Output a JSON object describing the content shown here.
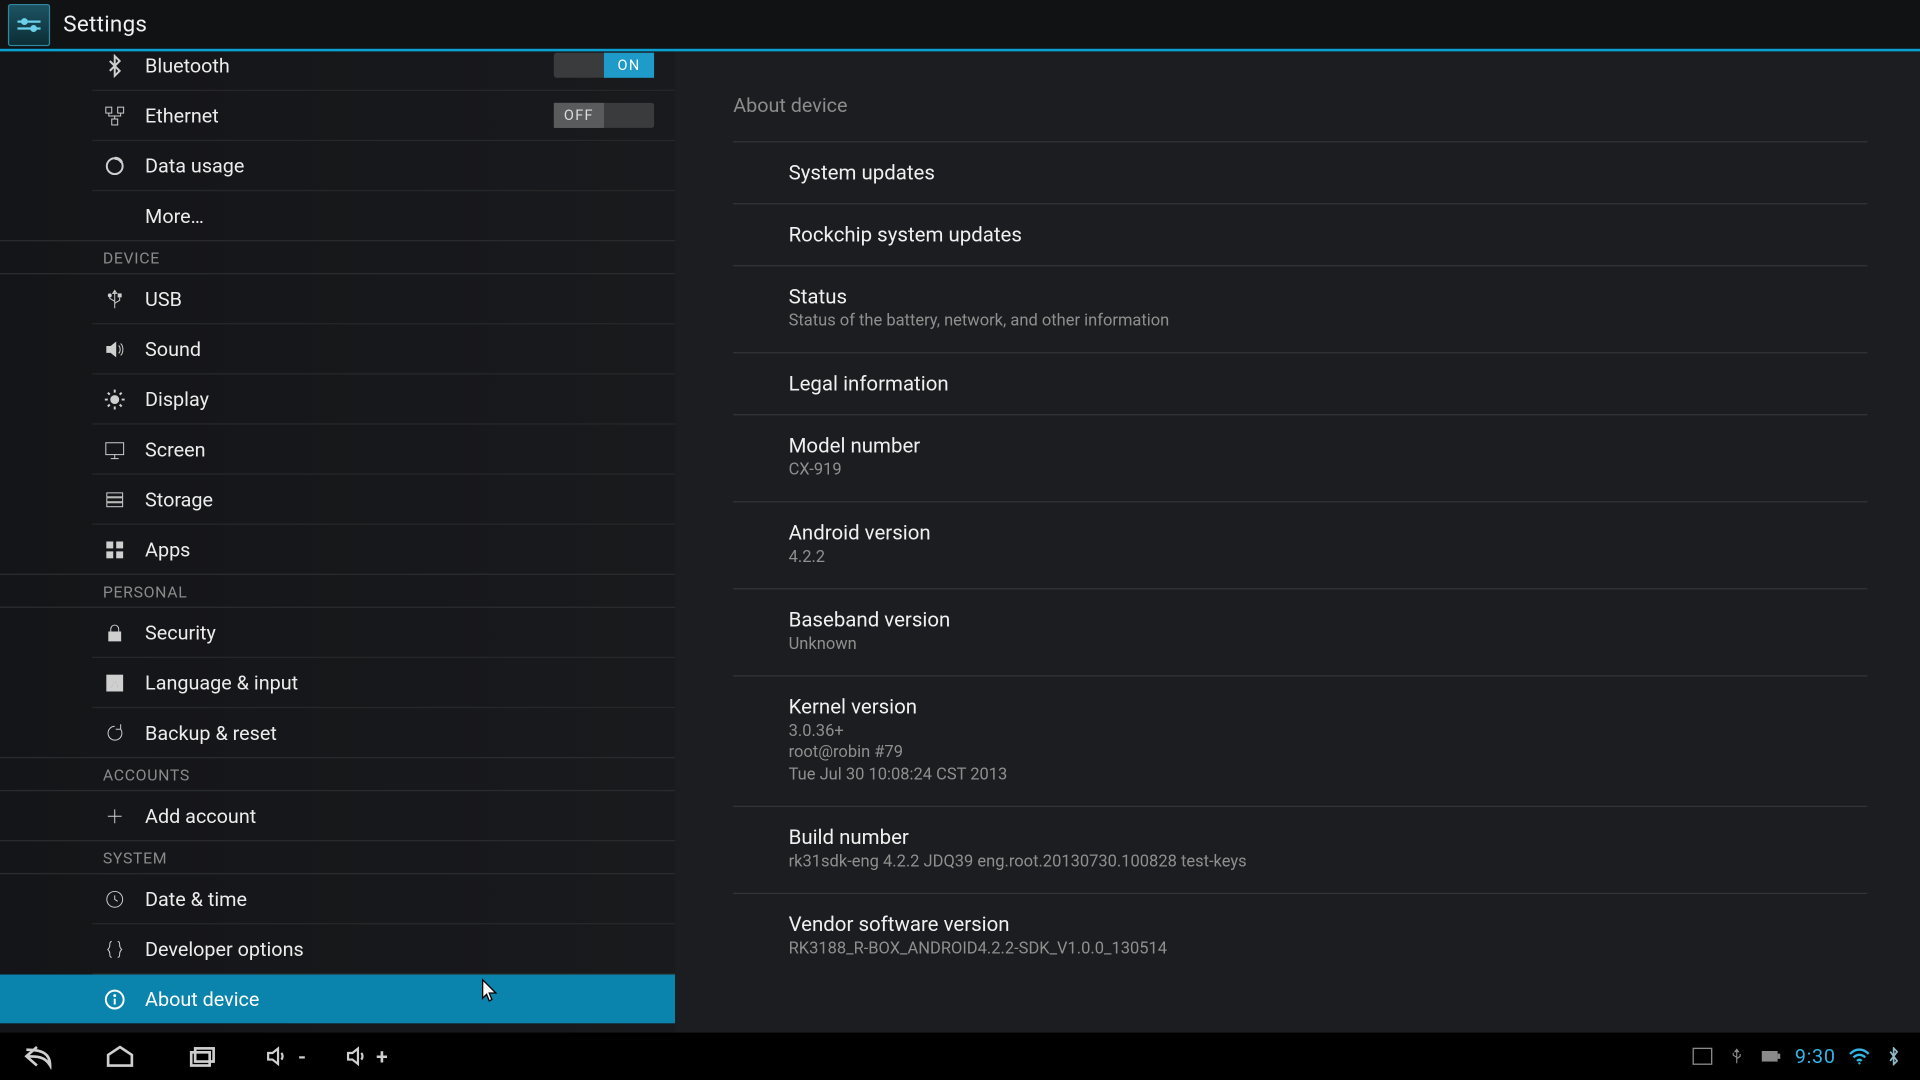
{
  "app": {
    "title": "Settings"
  },
  "toggles": {
    "on": "ON",
    "off": "OFF"
  },
  "sidebar": {
    "items": {
      "bluetooth": "Bluetooth",
      "ethernet": "Ethernet",
      "data_usage": "Data usage",
      "more": "More…",
      "usb": "USB",
      "sound": "Sound",
      "display": "Display",
      "screen": "Screen",
      "storage": "Storage",
      "apps": "Apps",
      "security": "Security",
      "language": "Language & input",
      "backup": "Backup & reset",
      "add_account": "Add account",
      "datetime": "Date & time",
      "devopts": "Developer options",
      "about": "About device"
    },
    "headers": {
      "device": "DEVICE",
      "personal": "PERSONAL",
      "accounts": "ACCOUNTS",
      "system": "SYSTEM"
    }
  },
  "about": {
    "title": "About device",
    "system_updates": "System updates",
    "rockchip_updates": "Rockchip system updates",
    "status": {
      "title": "Status",
      "sub": "Status of the battery, network, and other information"
    },
    "legal": "Legal information",
    "model": {
      "title": "Model number",
      "value": "CX-919"
    },
    "android": {
      "title": "Android version",
      "value": "4.2.2"
    },
    "baseband": {
      "title": "Baseband version",
      "value": "Unknown"
    },
    "kernel": {
      "title": "Kernel version",
      "value": "3.0.36+\nroot@robin #79\nTue Jul 30 10:08:24 CST 2013"
    },
    "build": {
      "title": "Build number",
      "value": "rk31sdk-eng 4.2.2 JDQ39 eng.root.20130730.100828 test-keys"
    },
    "vendor": {
      "title": "Vendor software version",
      "value": "RK3188_R-BOX_ANDROID4.2.2-SDK_V1.0.0_130514"
    }
  },
  "navbar": {
    "clock": "9:30"
  }
}
